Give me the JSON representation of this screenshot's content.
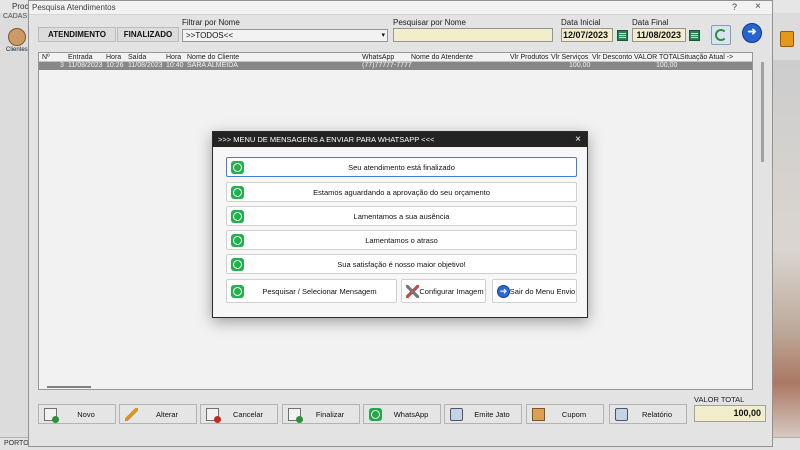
{
  "background": {
    "title": "Proc",
    "menu": "CADAS",
    "icon_label": "Clientes",
    "status": "PORTO"
  },
  "window": {
    "title": "Pesquisa Atendimentos",
    "help": "?",
    "close": "×"
  },
  "filters": {
    "btn_atendimento": "ATENDIMENTO",
    "btn_finalizado": "FINALIZADO",
    "filter_label": "Filtrar por Nome",
    "filter_value": ">>TODOS<<",
    "search_label": "Pesquisar por Nome",
    "search_value": "",
    "date_start_label": "Data Inicial",
    "date_start": "12/07/2023",
    "date_end_label": "Data Final",
    "date_end": "11/08/2023"
  },
  "grid": {
    "columns": [
      "Nº",
      "Entrada",
      "Hora",
      "Saída",
      "Hora",
      "Nome do Cliente",
      "WhatsApp",
      "Nome do Atendente",
      "Vlr Produtos",
      "Vlr Serviços",
      "Vlr Desconto",
      "VALOR TOTAL",
      "Situação Atual ->"
    ],
    "rows": [
      {
        "num": "3",
        "entrada": "11/08/2023",
        "hora1": "10:26",
        "saida": "11/08/2023",
        "hora2": "10:40",
        "cliente": "SARA ALMEIDA",
        "whatsapp": "(77)77777-7777",
        "atendente": "",
        "vlr_produtos": "",
        "vlr_servicos": "100,00",
        "vlr_desconto": "",
        "valor_total": "100,00",
        "situacao": ""
      }
    ]
  },
  "toolbar": {
    "novo": "Novo",
    "alterar": "Alterar",
    "cancelar": "Cancelar",
    "finalizar": "Finalizar",
    "whatsapp": "WhatsApp",
    "emite_jato": "Emite Jato",
    "cupom": "Cupom",
    "relatorio": "Relatório",
    "total_label": "VALOR TOTAL",
    "total_value": "100,00"
  },
  "modal": {
    "title": ">>> MENU DE MENSAGENS A ENVIAR PARA WHATSAPP <<<",
    "close": "×",
    "messages": [
      "Seu atendimento está finalizado",
      "Estamos aguardando a aprovação do seu orçamento",
      "Lamentamos a sua ausência",
      "Lamentamos o atraso",
      "Sua satisfação é nosso maior objetivo!"
    ],
    "btn_search": "Pesquisar / Selecionar Mensagem",
    "btn_config": "Configurar Imagem",
    "btn_exit": "Sair do Menu Envio"
  },
  "colors": {
    "whatsapp": "#25b04f",
    "highlight_row": "#8f8f8f",
    "input_yellow": "#fffbd6",
    "modal_title": "#232323"
  }
}
